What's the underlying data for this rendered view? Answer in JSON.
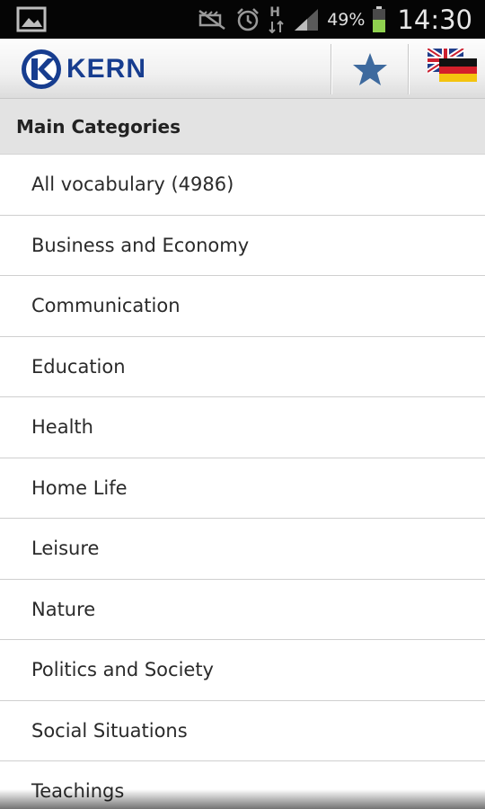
{
  "status_bar": {
    "battery_percent": "49%",
    "time": "14:30",
    "network_label": "H",
    "icons": [
      "image-icon",
      "mute-icon",
      "alarm-icon",
      "data-arrows-icon",
      "signal-icon",
      "battery-icon"
    ]
  },
  "action_bar": {
    "logo_text": "KERN",
    "logo_letter": "K",
    "brand_color": "#173d8f",
    "actions": [
      "favorites-star-icon",
      "language-flag-icon"
    ]
  },
  "section": {
    "title": "Main Categories"
  },
  "categories": [
    {
      "label": "All vocabulary (4986)"
    },
    {
      "label": "Business and Economy"
    },
    {
      "label": "Communication"
    },
    {
      "label": "Education"
    },
    {
      "label": "Health"
    },
    {
      "label": "Home Life"
    },
    {
      "label": "Leisure"
    },
    {
      "label": "Nature"
    },
    {
      "label": "Politics and Society"
    },
    {
      "label": "Social Situations"
    },
    {
      "label": "Teachings"
    }
  ]
}
